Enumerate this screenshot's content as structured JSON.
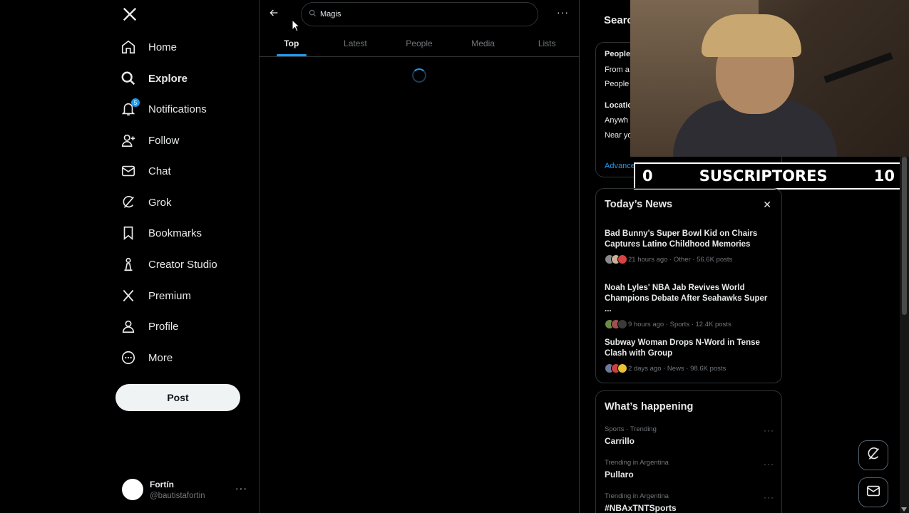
{
  "nav": {
    "items": [
      {
        "label": "Home",
        "icon": "home-icon"
      },
      {
        "label": "Explore",
        "icon": "search-icon"
      },
      {
        "label": "Notifications",
        "icon": "bell-icon",
        "badge": "5"
      },
      {
        "label": "Follow",
        "icon": "person-add-icon"
      },
      {
        "label": "Chat",
        "icon": "mail-icon"
      },
      {
        "label": "Grok",
        "icon": "grok-icon"
      },
      {
        "label": "Bookmarks",
        "icon": "bookmark-icon"
      },
      {
        "label": "Creator Studio",
        "icon": "creator-studio-icon"
      },
      {
        "label": "Premium",
        "icon": "x-logo-icon"
      },
      {
        "label": "Profile",
        "icon": "person-icon"
      },
      {
        "label": "More",
        "icon": "more-circle-icon"
      }
    ],
    "active": "Explore",
    "post_label": "Post"
  },
  "account": {
    "name": "Fortín",
    "handle": "@bautistafortin"
  },
  "search": {
    "query": "Magis"
  },
  "tabs": [
    {
      "label": "Top",
      "active": true
    },
    {
      "label": "Latest",
      "active": false
    },
    {
      "label": "People",
      "active": false
    },
    {
      "label": "Media",
      "active": false
    },
    {
      "label": "Lists",
      "active": false
    }
  ],
  "right": {
    "search_filters_title": "Searc",
    "filters": {
      "people_heading": "People",
      "people_option_1": "From a",
      "people_option_2": "People",
      "location_heading": "Locatio",
      "location_option_1": "Anywh",
      "location_option_2": "Near yo",
      "advanced": "Advanced search"
    },
    "news": {
      "title": "Today’s News",
      "items": [
        {
          "title": "Bad Bunny's Super Bowl Kid on Chairs Captures Latino Childhood Memories",
          "meta": "21 hours ago · Other · 56.6K posts"
        },
        {
          "title": "Noah Lyles' NBA Jab Revives World Champions Debate After Seahawks Super ...",
          "meta": "9 hours ago · Sports · 12.4K posts"
        },
        {
          "title": "Subway Woman Drops N-Word in Tense Clash with Group",
          "meta": "2 days ago · News · 98.6K posts"
        }
      ]
    },
    "happening": {
      "title": "What’s happening",
      "items": [
        {
          "context": "Sports · Trending",
          "name": "Carrillo"
        },
        {
          "context": "Trending in Argentina",
          "name": "Pullaro"
        },
        {
          "context": "Trending in Argentina",
          "name": "#NBAxTNTSports"
        }
      ]
    }
  },
  "overlay": {
    "sub_current": "0",
    "sub_label": "SUSCRIPTORES",
    "sub_goal": "10"
  },
  "colors": {
    "accent": "#1d9bf0",
    "background": "#000000",
    "border": "#2f3336",
    "muted": "#71767b"
  }
}
